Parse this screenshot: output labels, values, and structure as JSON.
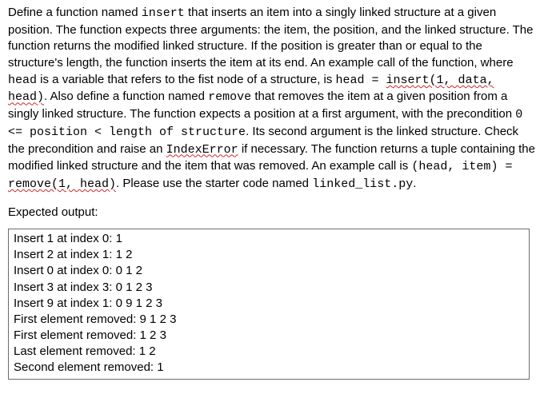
{
  "desc": {
    "t1": "Define a function named ",
    "c_insert": "insert",
    "t2": " that inserts an item into a singly linked structure at a given position. The function expects three arguments:  the item, the position, and the linked structure.  The function returns the modified linked structure.  If the position is greater than or equal to the structure's length, the function inserts the item at its end. An example call of the function, where ",
    "c_head": "head",
    "t3": " is a variable that refers to the fist node of a structure, is ",
    "c_head_eq": "head = ",
    "c_call_insert": "insert(1, data, head)",
    "t4": ". Also define a function named ",
    "c_remove": "remove",
    "t5": " that removes the item at a given position from a singly linked structure. The function expects a position at a first argument, with the precondition ",
    "c_precond": "0 <= position < length of structure",
    "t6": ". Its second argument is the linked structure. Check the precondition and raise an ",
    "c_indexerror": "IndexError",
    "t7": " if necessary. The function returns a tuple containing the modified linked structure and the item that was removed. An example call is ",
    "c_tuple": "(head, item) = ",
    "c_call_remove": "remove(1, head)",
    "t8": ". Please use the starter code named ",
    "c_file": "linked_list.py",
    "t9": "."
  },
  "expected_label": "Expected output:",
  "output_lines": [
    "Insert 1 at index 0: 1",
    "Insert 2 at index 1: 1 2",
    "Insert 0 at index 0: 0 1 2",
    "Insert 3 at index 3: 0 1 2 3",
    "Insert 9 at index 1: 0 9 1 2 3",
    "First element removed: 9 1 2 3",
    "First element removed: 1 2 3",
    "Last element removed: 1 2",
    "Second element removed: 1"
  ]
}
